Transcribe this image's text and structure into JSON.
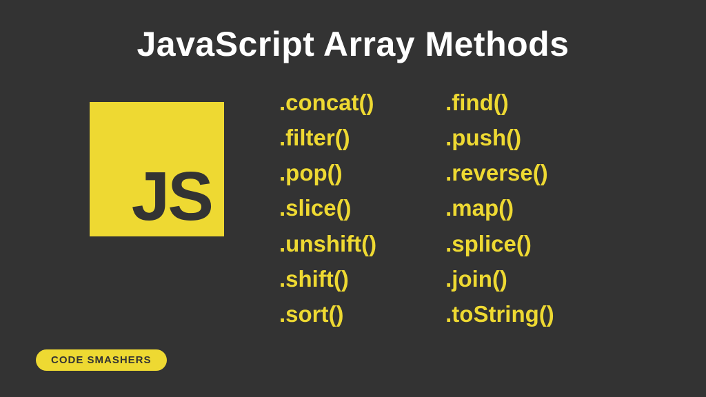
{
  "title": "JavaScript Array Methods",
  "logo": {
    "text": "JS"
  },
  "methods": {
    "column1": [
      ".concat()",
      ".filter()",
      ".pop()",
      ".slice()",
      ".unshift()",
      ".shift()",
      ".sort()"
    ],
    "column2": [
      ".find()",
      ".push()",
      ".reverse()",
      ".map()",
      ".splice()",
      ".join()",
      ".toString()"
    ]
  },
  "badge": "CODE SMASHERS",
  "colors": {
    "background": "#333333",
    "accent": "#eed932",
    "title": "#ffffff"
  }
}
